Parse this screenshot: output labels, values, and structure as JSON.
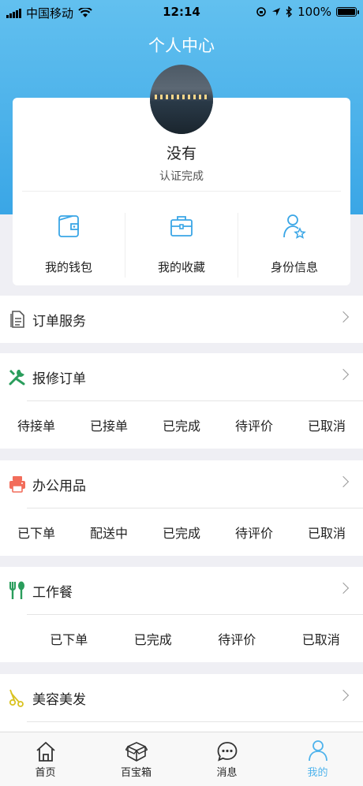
{
  "status_bar": {
    "carrier": "中国移动",
    "time": "12:14",
    "battery": "100%"
  },
  "header": {
    "title": "个人中心"
  },
  "profile": {
    "name": "没有",
    "auth_status": "认证完成"
  },
  "quick_links": [
    {
      "label": "我的钱包",
      "icon": "wallet-icon"
    },
    {
      "label": "我的收藏",
      "icon": "briefcase-icon"
    },
    {
      "label": "身份信息",
      "icon": "user-star-icon"
    }
  ],
  "order_service": {
    "label": "订单服务",
    "icon": "document-icon"
  },
  "repair": {
    "label": "报修订单",
    "icon": "tools-icon",
    "statuses": [
      "待接单",
      "已接单",
      "已完成",
      "待评价",
      "已取消"
    ]
  },
  "office": {
    "label": "办公用品",
    "icon": "printer-icon",
    "statuses": [
      "已下单",
      "配送中",
      "已完成",
      "待评价",
      "已取消"
    ]
  },
  "meal": {
    "label": "工作餐",
    "icon": "fork-spoon-icon",
    "statuses": [
      "已下单",
      "已完成",
      "待评价",
      "已取消"
    ]
  },
  "beauty": {
    "label": "美容美发",
    "icon": "scissors-icon"
  },
  "tabs": [
    {
      "label": "首页",
      "icon": "home-icon"
    },
    {
      "label": "百宝箱",
      "icon": "box-icon"
    },
    {
      "label": "消息",
      "icon": "message-icon"
    },
    {
      "label": "我的",
      "icon": "person-icon"
    }
  ],
  "colors": {
    "accent": "#4fb3ec",
    "header_top": "#62c0ef",
    "header_bottom": "#3aa6e6",
    "background": "#efeff4"
  }
}
